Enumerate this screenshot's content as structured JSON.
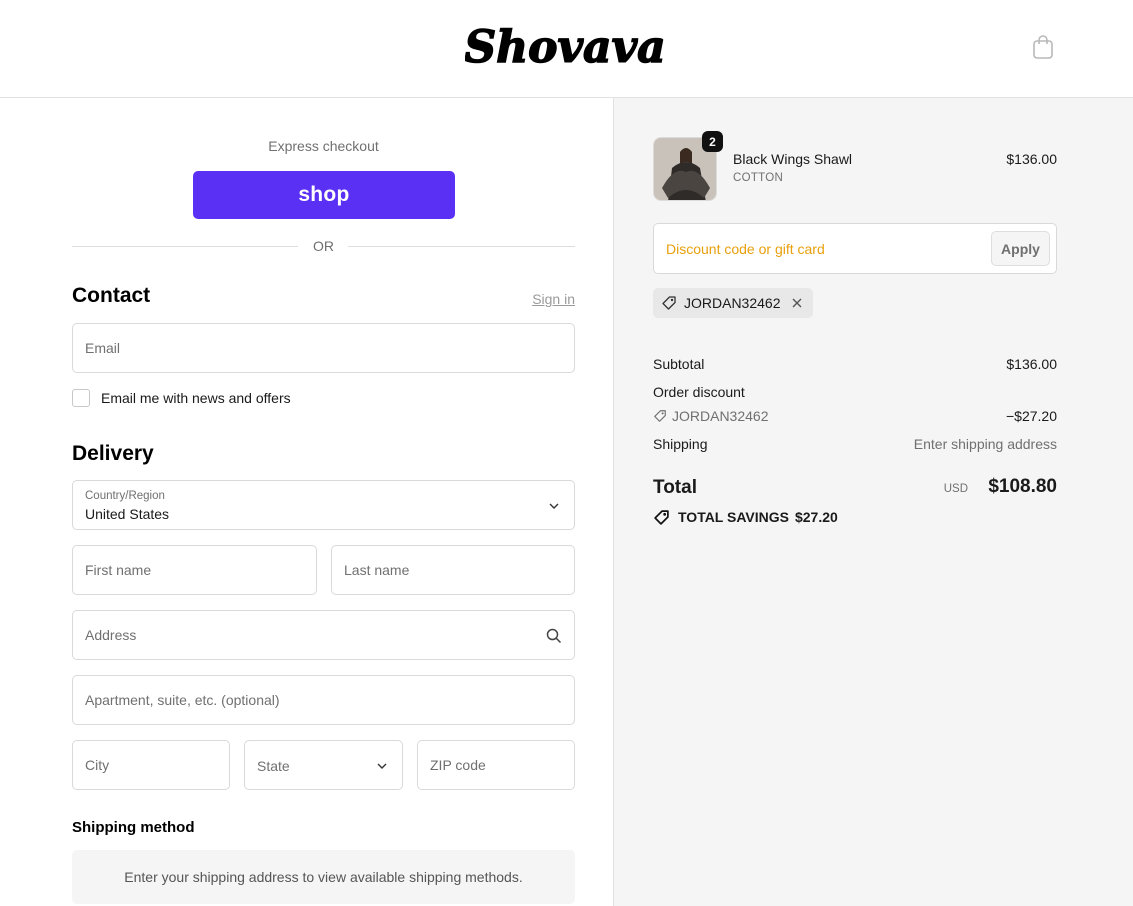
{
  "header": {
    "logo_text": "Shovava",
    "cart_icon": "shopping-bag-icon"
  },
  "express": {
    "label": "Express checkout",
    "shop_button": "shop",
    "or": "OR"
  },
  "contact": {
    "title": "Contact",
    "sign_in": "Sign in",
    "email_placeholder": "Email",
    "newsletter_label": "Email me with news and offers"
  },
  "delivery": {
    "title": "Delivery",
    "country_label": "Country/Region",
    "country_value": "United States",
    "first_name_placeholder": "First name",
    "last_name_placeholder": "Last name",
    "address_placeholder": "Address",
    "apartment_placeholder": "Apartment, suite, etc. (optional)",
    "city_placeholder": "City",
    "state_placeholder": "State",
    "zip_placeholder": "ZIP code"
  },
  "shipping_method": {
    "title": "Shipping method",
    "message": "Enter your shipping address to view available shipping methods."
  },
  "order": {
    "product": {
      "name": "Black Wings Shawl",
      "variant": "COTTON",
      "price": "$136.00",
      "quantity": "2"
    },
    "discount_placeholder": "Discount code or gift card",
    "apply_label": "Apply",
    "applied_code": "JORDAN32462",
    "subtotal_label": "Subtotal",
    "subtotal_value": "$136.00",
    "order_discount_label": "Order discount",
    "discount_code": "JORDAN32462",
    "discount_value": "−$27.20",
    "shipping_label": "Shipping",
    "shipping_value": "Enter shipping address",
    "total_label": "Total",
    "currency": "USD",
    "total_value": "$108.80",
    "savings_label": "TOTAL SAVINGS",
    "savings_value": "$27.20"
  },
  "colors": {
    "shop_purple": "#5a31f4",
    "discount_placeholder": "#e8a00c",
    "summary_bg": "#f5f5f5"
  }
}
